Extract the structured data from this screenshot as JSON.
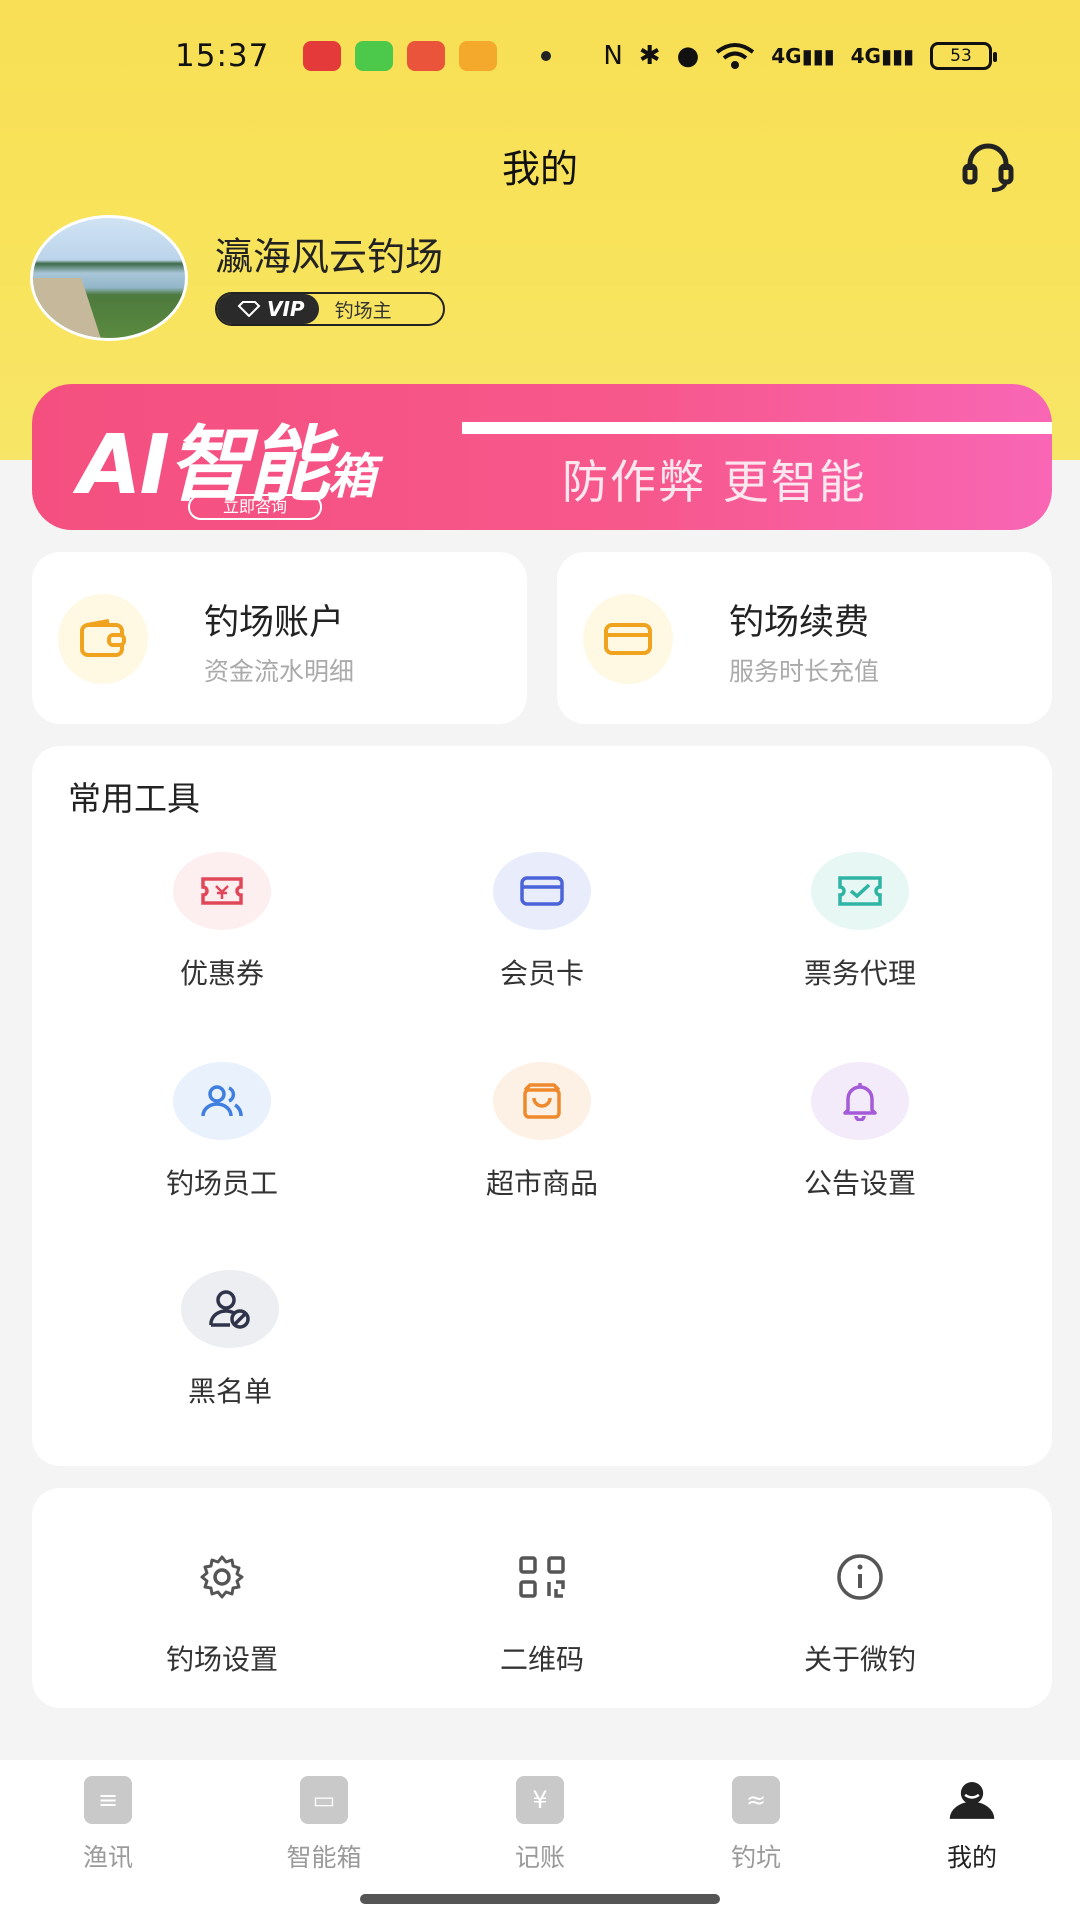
{
  "status_bar": {
    "time": "15:37",
    "battery": "53",
    "signal_1": "4G",
    "signal_2": "4G"
  },
  "header": {
    "title": "我的"
  },
  "profile": {
    "name": "瀛海风云钓场",
    "vip_label": "VIP",
    "role": "钓场主"
  },
  "banner": {
    "title_main": "AI智能",
    "title_small": "箱",
    "consult": "立即咨询",
    "slogan": "防作弊 更智能"
  },
  "accounts": [
    {
      "title": "钓场账户",
      "subtitle": "资金流水明细",
      "icon": "wallet-icon"
    },
    {
      "title": "钓场续费",
      "subtitle": "服务时长充值",
      "icon": "card-icon"
    }
  ],
  "tools": {
    "title": "常用工具",
    "items": [
      {
        "label": "优惠券",
        "icon": "ticket-icon",
        "color": "#e0485a",
        "bg": "#fdeef0"
      },
      {
        "label": "会员卡",
        "icon": "card-icon",
        "color": "#4a63d9",
        "bg": "#e9ecfb"
      },
      {
        "label": "票务代理",
        "icon": "ticket-check-icon",
        "color": "#2fb3a3",
        "bg": "#e6f7f4"
      },
      {
        "label": "钓场员工",
        "icon": "users-icon",
        "color": "#3f7fe0",
        "bg": "#e8f1fc"
      },
      {
        "label": "超市商品",
        "icon": "bag-icon",
        "color": "#ee8a2d",
        "bg": "#fdf1e5"
      },
      {
        "label": "公告设置",
        "icon": "bell-icon",
        "color": "#a45bd8",
        "bg": "#f3ebfa"
      },
      {
        "label": "黑名单",
        "icon": "user-blocked-icon",
        "color": "#30344a",
        "bg": "#eceef2"
      }
    ]
  },
  "settings": {
    "items": [
      {
        "label": "钓场设置",
        "icon": "gear-icon"
      },
      {
        "label": "二维码",
        "icon": "qrcode-icon"
      },
      {
        "label": "关于微钓",
        "icon": "info-icon"
      }
    ]
  },
  "tabbar": {
    "items": [
      {
        "label": "渔讯",
        "icon": "news-icon"
      },
      {
        "label": "智能箱",
        "icon": "box-icon"
      },
      {
        "label": "记账",
        "icon": "ledger-icon"
      },
      {
        "label": "钓坑",
        "icon": "pond-icon"
      },
      {
        "label": "我的",
        "icon": "profile-icon"
      }
    ],
    "active_index": 4
  }
}
